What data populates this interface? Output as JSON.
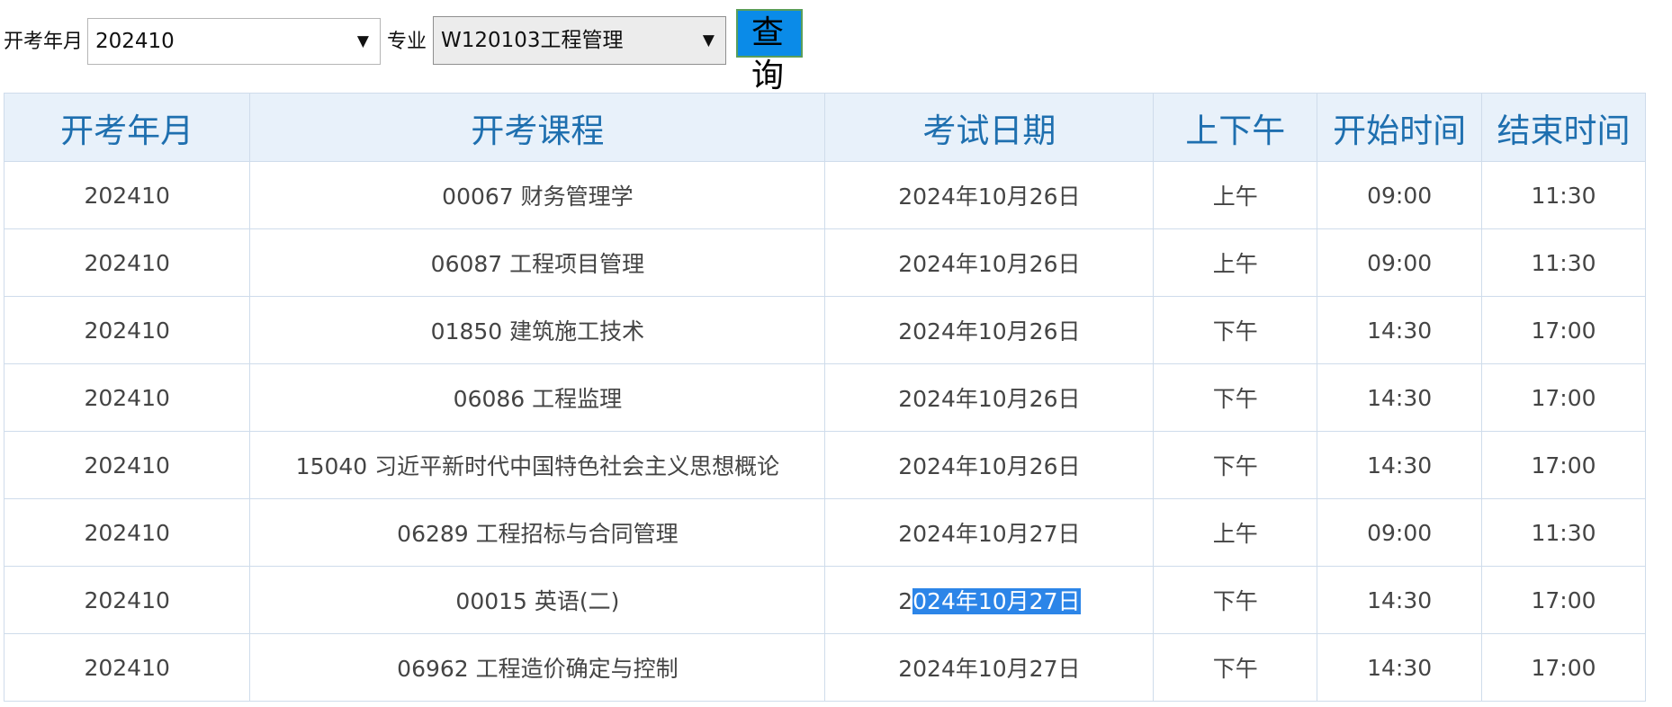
{
  "filters": {
    "exam_month_label": "开考年月",
    "exam_month_value": "202410",
    "major_label": "专业",
    "major_value": "W120103工程管理",
    "arrow_glyph": "▼",
    "query_button": "查询"
  },
  "table": {
    "headers": [
      "开考年月",
      "开考课程",
      "考试日期",
      "上下午",
      "开始时间",
      "结束时间"
    ],
    "rows": [
      [
        "202410",
        "00067 财务管理学",
        "2024年10月26日",
        "上午",
        "09:00",
        "11:30"
      ],
      [
        "202410",
        "06087 工程项目管理",
        "2024年10月26日",
        "上午",
        "09:00",
        "11:30"
      ],
      [
        "202410",
        "01850 建筑施工技术",
        "2024年10月26日",
        "下午",
        "14:30",
        "17:00"
      ],
      [
        "202410",
        "06086 工程监理",
        "2024年10月26日",
        "下午",
        "14:30",
        "17:00"
      ],
      [
        "202410",
        "15040 习近平新时代中国特色社会主义思想概论",
        "2024年10月26日",
        "下午",
        "14:30",
        "17:00"
      ],
      [
        "202410",
        "06289 工程招标与合同管理",
        "2024年10月27日",
        "上午",
        "09:00",
        "11:30"
      ],
      [
        "202410",
        "00015 英语(二)",
        "2024年10月27日",
        "下午",
        "14:30",
        "17:00"
      ],
      [
        "202410",
        "06962 工程造价确定与控制",
        "2024年10月27日",
        "下午",
        "14:30",
        "17:00"
      ]
    ],
    "selection": {
      "row": 6,
      "col": 2,
      "unselected_part": "2",
      "selected_part": "024年10月27日"
    }
  },
  "colors": {
    "header_bg": "#e8f1fa",
    "header_text": "#1e6faf",
    "border": "#cfdceb",
    "query_button_bg": "#0a8be8",
    "selection_bg": "#2c85e8"
  }
}
